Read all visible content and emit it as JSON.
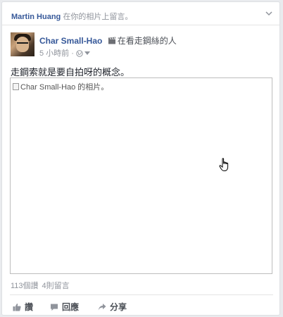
{
  "notification": {
    "actor": "Martin Huang",
    "text": " 在你的相片上留言。",
    "menu_icon": "chevron-down-icon"
  },
  "post": {
    "author": "Char Small-Hao",
    "activity_icon": "clapperboard-icon",
    "activity": "在看走鋼絲的人",
    "time": "5 小時前",
    "separator": "·",
    "privacy_icon": "globe-icon",
    "text": "走鋼索就是要自拍呀的概念。",
    "photo_alt": "Char Small-Hao 的相片。"
  },
  "stats": {
    "likes": "113個讚",
    "comments": "4則留言"
  },
  "actions": {
    "like": "讚",
    "comment": "回應",
    "share": "分享"
  },
  "colors": {
    "link": "#365899",
    "meta": "#90949c",
    "border": "#dddfe2"
  }
}
